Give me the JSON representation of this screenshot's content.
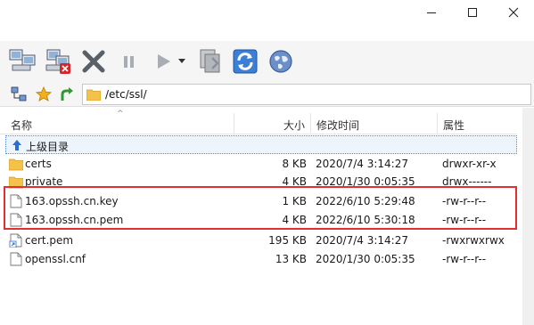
{
  "window": {
    "minimize_icon": "minimize-icon",
    "maximize_icon": "maximize-icon",
    "close_icon": "close-icon"
  },
  "toolbar": {
    "icons": [
      "connect-icon",
      "disconnect-icon",
      "cancel-icon",
      "pause-icon",
      "play-icon",
      "dropdown-icon",
      "queue-icon",
      "refresh-icon",
      "web-icon"
    ]
  },
  "pathbar": {
    "path": "/etc/ssl/"
  },
  "columns": {
    "name": "名称",
    "size": "大小",
    "modified": "修改时间",
    "attrs": "属性"
  },
  "rows": [
    {
      "name": "上级目录",
      "size": "",
      "modified": "",
      "attrs": "",
      "type": "parent"
    },
    {
      "name": "certs",
      "size": "8 KB",
      "modified": "2020/7/4 3:14:27",
      "attrs": "drwxr-xr-x",
      "type": "folder"
    },
    {
      "name": "private",
      "size": "4 KB",
      "modified": "2020/1/30 0:05:35",
      "attrs": "drwx------",
      "type": "folder"
    },
    {
      "name": "163.opssh.cn.key",
      "size": "1 KB",
      "modified": "2022/6/10 5:29:48",
      "attrs": "-rw-r--r--",
      "type": "file"
    },
    {
      "name": "163.opssh.cn.pem",
      "size": "4 KB",
      "modified": "2022/6/10 5:30:18",
      "attrs": "-rw-r--r--",
      "type": "file"
    },
    {
      "name": "cert.pem",
      "size": "195 KB",
      "modified": "2020/7/4 3:14:27",
      "attrs": "-rwxrwxrwx",
      "type": "link"
    },
    {
      "name": "openssl.cnf",
      "size": "13 KB",
      "modified": "2020/1/30 0:05:35",
      "attrs": "-rw-r--r--",
      "type": "file"
    }
  ],
  "colors": {
    "highlight": "#e03030",
    "folder": "#f4c14a",
    "parent_row_bg": "#eef4fc"
  }
}
